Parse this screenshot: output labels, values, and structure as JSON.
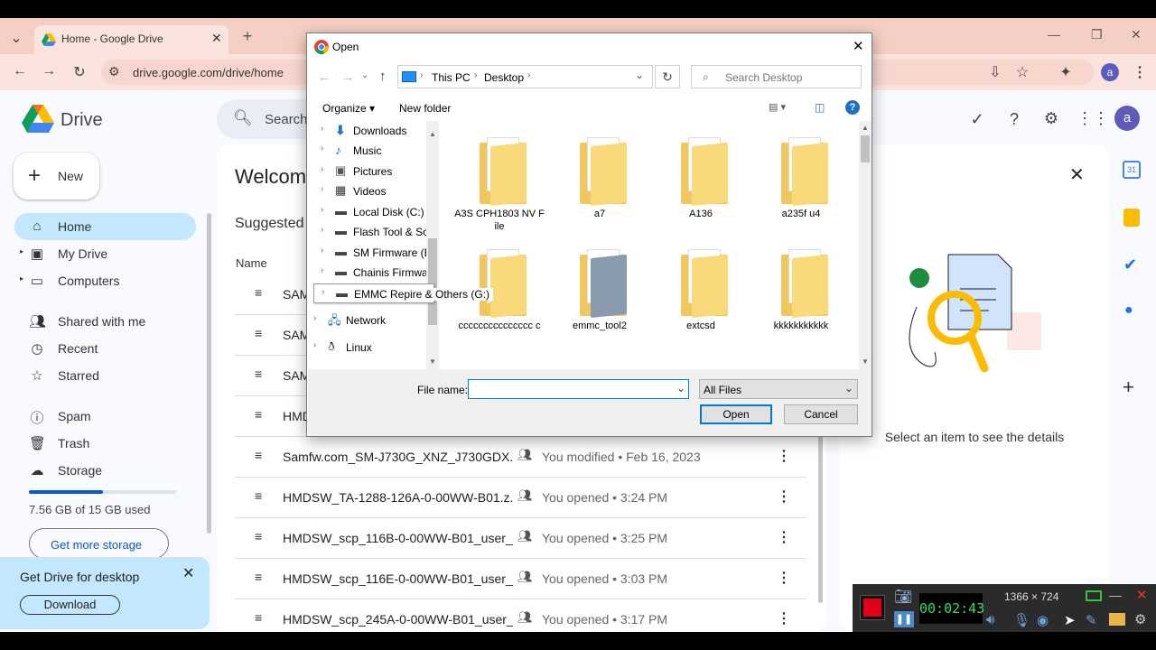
{
  "browser": {
    "tab_title": "Home - Google Drive",
    "url": "drive.google.com/drive/home",
    "profile_letter": "a"
  },
  "drive": {
    "app_name": "Drive",
    "search_placeholder": "Search",
    "new_label": "New",
    "nav": [
      {
        "label": "Home",
        "icon": "home-icon"
      },
      {
        "label": "My Drive",
        "icon": "my-drive-icon"
      },
      {
        "label": "Computers",
        "icon": "computers-icon"
      },
      {
        "label": "Shared with me",
        "icon": "shared-icon"
      },
      {
        "label": "Recent",
        "icon": "recent-icon"
      },
      {
        "label": "Starred",
        "icon": "star-icon"
      },
      {
        "label": "Spam",
        "icon": "spam-icon"
      },
      {
        "label": "Trash",
        "icon": "trash-icon"
      },
      {
        "label": "Storage",
        "icon": "cloud-icon"
      }
    ],
    "storage_used_text": "7.56 GB of 15 GB used",
    "storage_fraction": 0.504,
    "get_storage_label": "Get more storage",
    "promo_title": "Get Drive for desktop",
    "promo_download": "Download",
    "welcome": "Welcom",
    "suggested": "Suggested",
    "name_header": "Name",
    "files": [
      {
        "name": "SAM",
        "modified": ""
      },
      {
        "name": "SAM",
        "modified": ""
      },
      {
        "name": "SAM",
        "modified": ""
      },
      {
        "name": "HMD",
        "modified": ""
      },
      {
        "name": "Samfw.com_SM-J730G_XNZ_J730GDX...",
        "modified": "You modified • Feb 16, 2023"
      },
      {
        "name": "HMDSW_TA-1288-126A-0-00WW-B01.z...",
        "modified": "You opened • 3:24 PM"
      },
      {
        "name": "HMDSW_scp_116B-0-00WW-B01_user_...",
        "modified": "You opened • 3:25 PM"
      },
      {
        "name": "HMDSW_scp_116E-0-00WW-B01_user_...",
        "modified": "You opened • 3:03 PM"
      },
      {
        "name": "HMDSW_scp_245A-0-00WW-B01_user_...",
        "modified": "You opened • 3:17 PM"
      }
    ],
    "details_empty": "Select an item to see the details"
  },
  "dialog": {
    "title": "Open",
    "crumbs": [
      "This PC",
      "Desktop"
    ],
    "search_placeholder": "Search Desktop",
    "organize": "Organize ▾",
    "new_folder": "New folder",
    "tree": [
      {
        "label": "Downloads",
        "icon": "downloads-icon"
      },
      {
        "label": "Music",
        "icon": "music-icon"
      },
      {
        "label": "Pictures",
        "icon": "pictures-icon"
      },
      {
        "label": "Videos",
        "icon": "videos-icon"
      },
      {
        "label": "Local Disk (C:)",
        "icon": "drive-icon"
      },
      {
        "label": "Flash Tool & Sch",
        "icon": "drive-icon"
      },
      {
        "label": "SM Firmware (E:",
        "icon": "drive-icon"
      },
      {
        "label": "Chainis Firmwar",
        "icon": "drive-icon"
      },
      {
        "label": "EMMC Repire & Others (G:)",
        "icon": "drive-icon"
      },
      {
        "label": "Network",
        "icon": "network-icon"
      },
      {
        "label": "Linux",
        "icon": "linux-icon"
      }
    ],
    "folders": [
      {
        "name": "A3S CPH1803 NV File"
      },
      {
        "name": "a7"
      },
      {
        "name": "A136"
      },
      {
        "name": "a235f u4"
      },
      {
        "name": "ccccccccccccccc c"
      },
      {
        "name": "emmc_tool2"
      },
      {
        "name": "extcsd"
      },
      {
        "name": "kkkkkkkkkkk"
      }
    ],
    "filename_label": "File name:",
    "filename_value": "",
    "filetype": "All Files",
    "open_btn": "Open",
    "cancel_btn": "Cancel"
  },
  "recorder": {
    "timer": "00:02:43",
    "resolution": "1366 × 724"
  }
}
